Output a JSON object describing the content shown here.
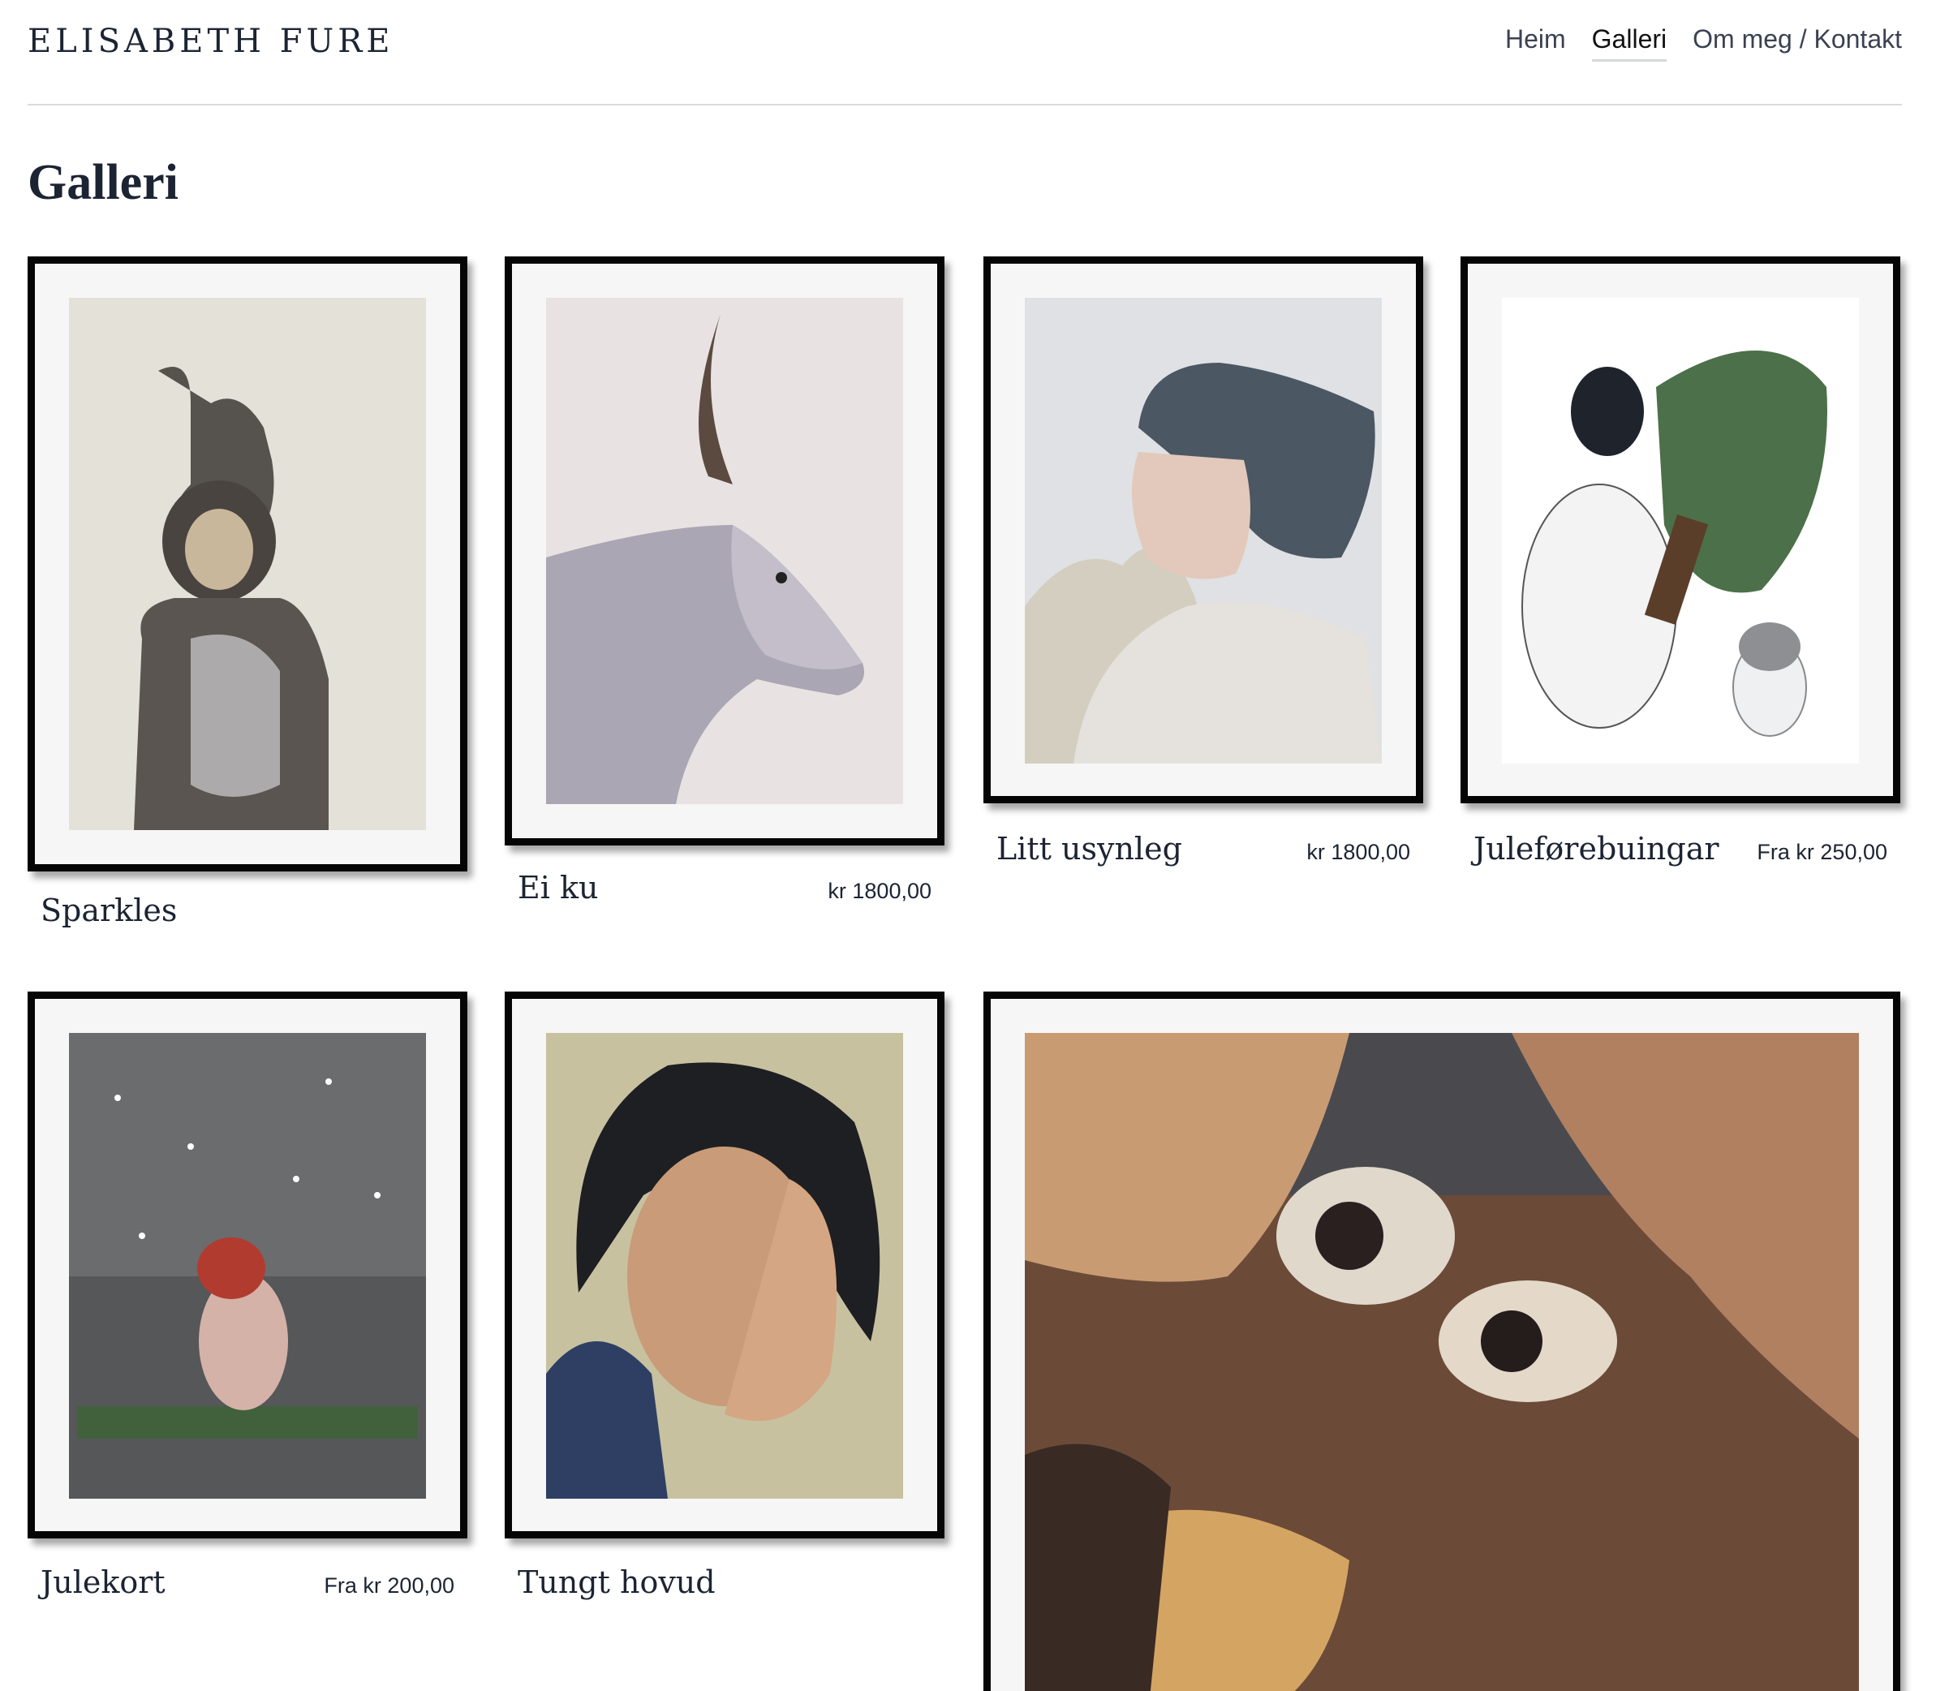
{
  "site": {
    "brand": "ELISABETH FURE"
  },
  "nav": [
    {
      "label": "Heim",
      "active": false
    },
    {
      "label": "Galleri",
      "active": true
    },
    {
      "label": "Om meg / Kontakt",
      "active": false
    }
  ],
  "page": {
    "title": "Galleri"
  },
  "gallery": [
    {
      "title": "Sparkles",
      "price": "",
      "art": "chimpanzee-painting"
    },
    {
      "title": "Ei ku",
      "price": "kr 1800,00",
      "art": "cow-painting"
    },
    {
      "title": "Litt usynleg",
      "price": "kr 1800,00",
      "art": "portrait-man-painting"
    },
    {
      "title": "Juleførebuingar",
      "price": "Fra kr 250,00",
      "art": "penguins-painting"
    },
    {
      "title": "Julekort",
      "price": "Fra kr 200,00",
      "art": "bird-in-snow-painting"
    },
    {
      "title": "Tungt hovud",
      "price": "",
      "art": "portrait-woman-painting"
    },
    {
      "title": "",
      "price": "",
      "art": "face-closeup-painting"
    }
  ]
}
